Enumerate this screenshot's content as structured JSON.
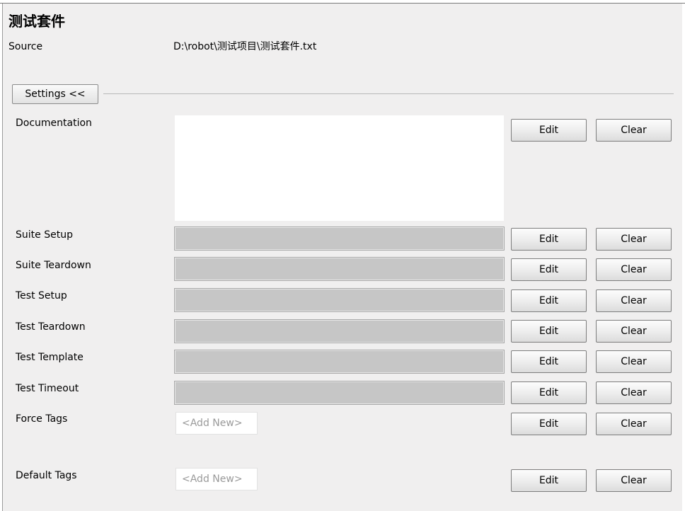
{
  "page": {
    "title": "测试套件",
    "source_label": "Source",
    "source_value": "D:\\robot\\测试项目\\测试套件.txt"
  },
  "settings": {
    "toggle_label": "Settings <<",
    "edit_label": "Edit",
    "clear_label": "Clear",
    "add_new_placeholder": "<Add New>",
    "rows": [
      {
        "label": "Documentation"
      },
      {
        "label": "Suite Setup"
      },
      {
        "label": "Suite Teardown"
      },
      {
        "label": "Test Setup"
      },
      {
        "label": "Test Teardown"
      },
      {
        "label": "Test Template"
      },
      {
        "label": "Test Timeout"
      },
      {
        "label": "Force Tags"
      },
      {
        "label": "Default Tags"
      }
    ]
  }
}
